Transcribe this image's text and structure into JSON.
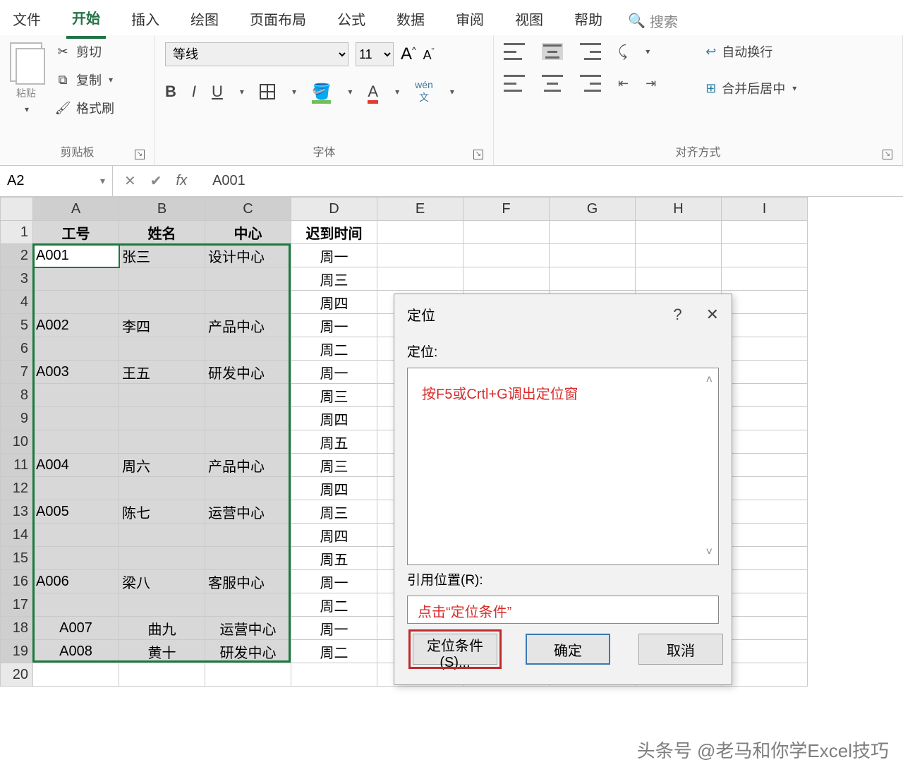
{
  "ribbon": {
    "tabs": [
      "文件",
      "开始",
      "插入",
      "绘图",
      "页面布局",
      "公式",
      "数据",
      "审阅",
      "视图",
      "帮助"
    ],
    "activeTab": "开始",
    "search": "搜索"
  },
  "clipboard": {
    "paste": "粘贴",
    "cut": "剪切",
    "copy": "复制",
    "formatPainter": "格式刷",
    "group": "剪贴板"
  },
  "font": {
    "name": "等线",
    "size": "11",
    "increase": "A",
    "decrease": "A",
    "bold": "B",
    "italic": "I",
    "underline": "U",
    "wen": "wén",
    "wenSub": "文",
    "group": "字体"
  },
  "alignment": {
    "wrap": "自动换行",
    "merge": "合并后居中",
    "group": "对齐方式"
  },
  "formula": {
    "namebox": "A2",
    "value": "A001"
  },
  "columns": [
    "A",
    "B",
    "C",
    "D",
    "E",
    "F",
    "G",
    "H",
    "I"
  ],
  "rows": [
    "1",
    "2",
    "3",
    "4",
    "5",
    "6",
    "7",
    "8",
    "9",
    "10",
    "11",
    "12",
    "13",
    "14",
    "15",
    "16",
    "17",
    "18",
    "19",
    "20"
  ],
  "table": {
    "headers": [
      "工号",
      "姓名",
      "中心",
      "迟到时间"
    ],
    "data": [
      [
        "A001",
        "张三",
        "设计中心",
        "周一"
      ],
      [
        "",
        "",
        "",
        "周三"
      ],
      [
        "",
        "",
        "",
        "周四"
      ],
      [
        "A002",
        "李四",
        "产品中心",
        "周一"
      ],
      [
        "",
        "",
        "",
        "周二"
      ],
      [
        "A003",
        "王五",
        "研发中心",
        "周一"
      ],
      [
        "",
        "",
        "",
        "周三"
      ],
      [
        "",
        "",
        "",
        "周四"
      ],
      [
        "",
        "",
        "",
        "周五"
      ],
      [
        "A004",
        "周六",
        "产品中心",
        "周三"
      ],
      [
        "",
        "",
        "",
        "周四"
      ],
      [
        "A005",
        "陈七",
        "运营中心",
        "周三"
      ],
      [
        "",
        "",
        "",
        "周四"
      ],
      [
        "",
        "",
        "",
        "周五"
      ],
      [
        "A006",
        "梁八",
        "客服中心",
        "周一"
      ],
      [
        "",
        "",
        "",
        "周二"
      ],
      [
        "A007",
        "曲九",
        "运营中心",
        "周一"
      ],
      [
        "A008",
        "黄十",
        "研发中心",
        "周二"
      ]
    ]
  },
  "dialog": {
    "title": "定位",
    "gotoLabel": "定位:",
    "hint": "按F5或Crtl+G调出定位窗",
    "refLabel": "引用位置(R):",
    "refHint": "点击“定位条件”",
    "special": "定位条件(S)...",
    "ok": "确定",
    "cancel": "取消"
  },
  "watermark": "头条号 @老马和你学Excel技巧"
}
